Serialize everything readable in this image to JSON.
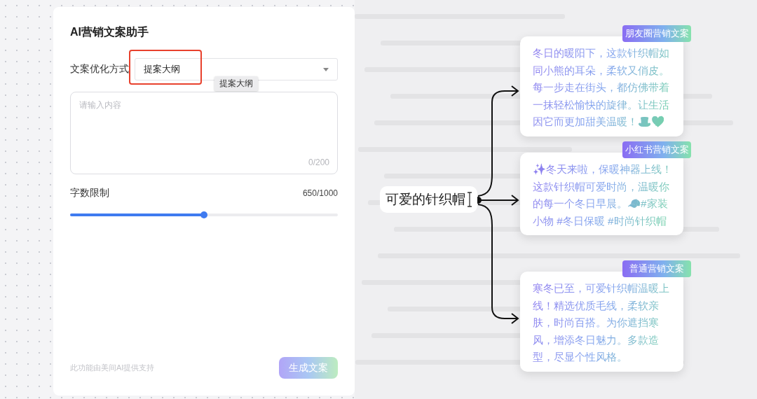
{
  "panel": {
    "title": "AI营销文案助手",
    "method": {
      "label": "文案优化方式",
      "value": "提案大纲",
      "highlighted": true,
      "tooltip": "提案大纲"
    },
    "content": {
      "placeholder": "请输入内容",
      "counter": "0/200"
    },
    "word_limit": {
      "label": "字数限制",
      "reading": "650/1000",
      "level": 0.5
    },
    "footer_note": "此功能由美间AI提供支持",
    "generate_button": "生成文案"
  },
  "mind_map": {
    "root": "可爱的针织帽",
    "branches": [
      {
        "tag": "朋友圈营销文案",
        "text": "冬日的暖阳下，这款针织帽如同小熊的耳朵，柔软又俏皮。每一步走在街头，都仿佛带着一抹轻松愉快的旋律。让生活因它而更加甜美温暖！🎩💖"
      },
      {
        "tag": "小红书营销文案",
        "text": "✨冬天来啦，保暖神器上线！这款针织帽可爱时尚，温暖你的每一个冬日早晨。🧢#家装小物 #冬日保暖 #时尚针织帽"
      },
      {
        "tag": "普通营销文案",
        "text": "寒冬已至，可爱针织帽温暖上线！精选优质毛线，柔软亲肤，时尚百搭。为你遮挡寒风，增添冬日魅力。多款造型，尽显个性风格。"
      }
    ]
  }
}
